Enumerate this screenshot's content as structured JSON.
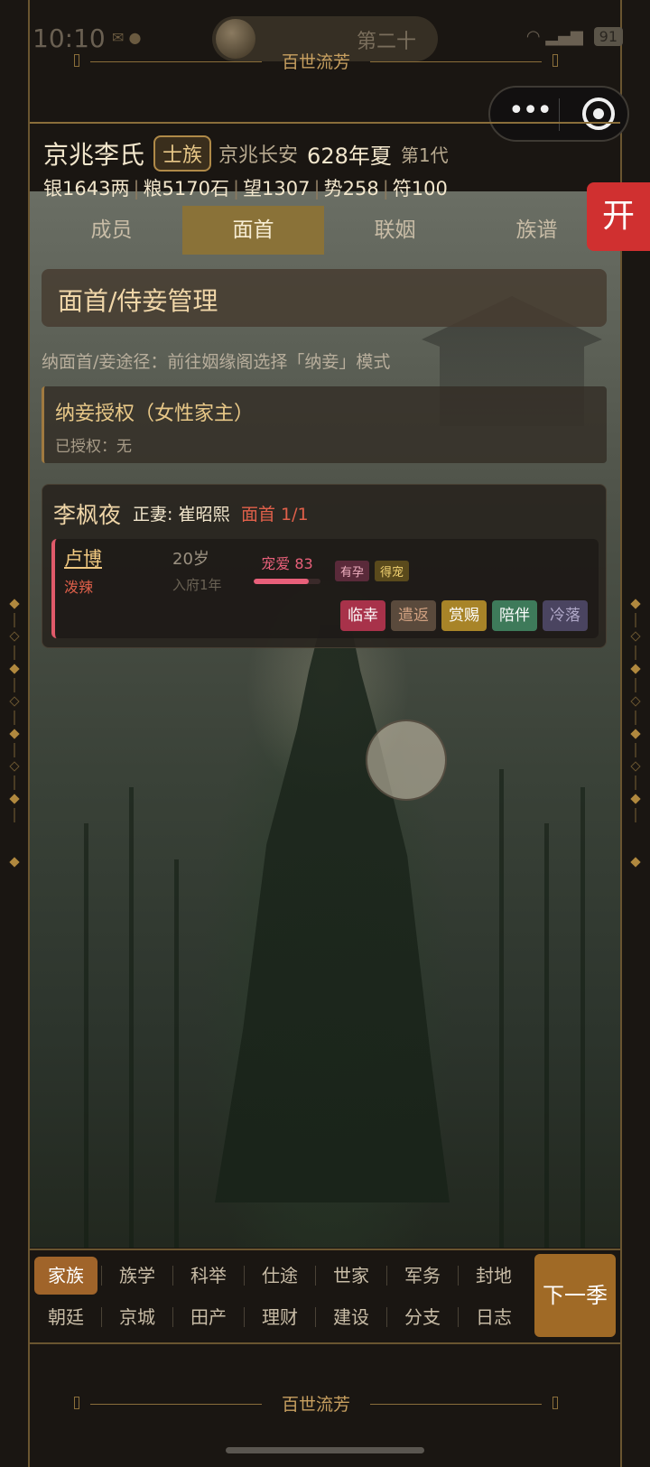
{
  "status_bar": {
    "time": "10:10",
    "era": "第二十",
    "battery": "91"
  },
  "brand": {
    "name": "百世流芳"
  },
  "header": {
    "family_name": "京兆李氏",
    "rank": "士族",
    "place": "京兆长安",
    "year": "628年夏",
    "generation": "第1代",
    "resources": [
      "银1643两",
      "粮5170石",
      "望1307",
      "势258",
      "符100"
    ]
  },
  "open_button": "开",
  "tabs": [
    {
      "label": "成员",
      "active": false
    },
    {
      "label": "面首",
      "active": true
    },
    {
      "label": "联姻",
      "active": false
    },
    {
      "label": "族谱",
      "active": false
    }
  ],
  "page": {
    "title": "面首/侍妾管理",
    "hint": "纳面首/妾途径：前往姻缘阁选择「纳妾」模式"
  },
  "authorization": {
    "title": "纳妾授权（女性家主）",
    "status": "已授权：无"
  },
  "member": {
    "name": "李枫夜",
    "spouse": "正妻: 崔昭熙",
    "count": "面首 1/1",
    "concubine": {
      "name": "卢博",
      "trait": "泼辣",
      "age": "20岁",
      "tenure": "入府1年",
      "favor_label": "宠爱 83",
      "favor_value": 83,
      "badges": [
        "有孕",
        "得宠"
      ],
      "actions": [
        "临幸",
        "遣返",
        "赏赐",
        "陪伴",
        "冷落"
      ]
    }
  },
  "nav": {
    "row1": [
      "家族",
      "族学",
      "科举",
      "仕途",
      "世家",
      "军务",
      "封地"
    ],
    "row2": [
      "朝廷",
      "京城",
      "田产",
      "理财",
      "建设",
      "分支",
      "日志"
    ],
    "active": "家族",
    "next": "下一季"
  },
  "colors": {
    "accent": "#8a7238",
    "gold": "#b08a48",
    "favor": "#e8607a",
    "danger": "#d03030"
  }
}
